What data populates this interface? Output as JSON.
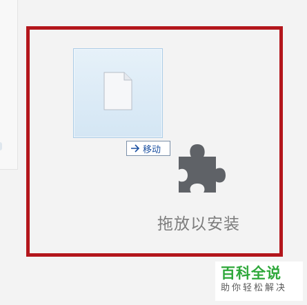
{
  "drop_zone": {
    "move_badge_label": "移动",
    "install_label": "拖放以安装",
    "border_color": "#b3161c",
    "icons": {
      "file": "file-icon",
      "move_arrow": "arrow-right-icon",
      "extension": "puzzle-piece-icon"
    }
  },
  "watermark": {
    "title": "百科全说",
    "subtitle": "助你轻松解决",
    "accent_color": "#2ea83a"
  }
}
